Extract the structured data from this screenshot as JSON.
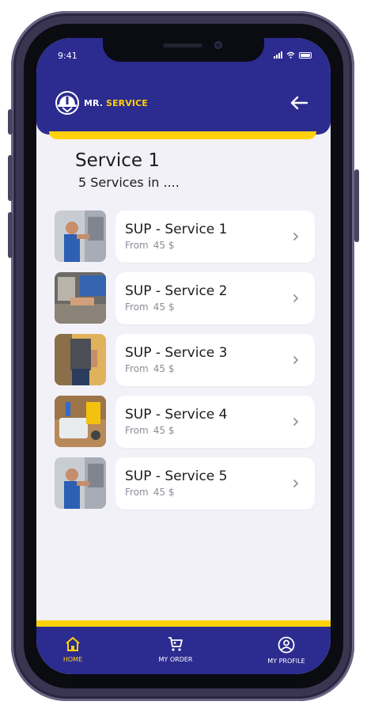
{
  "status": {
    "time": "9:41"
  },
  "header": {
    "brand_first": "MR.",
    "brand_second": "SERVICE"
  },
  "page": {
    "title": "Service 1",
    "subtitle": "5 Services in ...."
  },
  "services": [
    {
      "name": "SUP - Service 1",
      "price_prefix": "From",
      "price": "45 $"
    },
    {
      "name": "SUP - Service 2",
      "price_prefix": "From",
      "price": "45 $"
    },
    {
      "name": "SUP - Service 3",
      "price_prefix": "From",
      "price": "45 $"
    },
    {
      "name": "SUP - Service 4",
      "price_prefix": "From",
      "price": "45 $"
    },
    {
      "name": "SUP - Service 5",
      "price_prefix": "From",
      "price": "45 $"
    }
  ],
  "nav": [
    {
      "label": "HOME",
      "icon": "home-icon",
      "active": true
    },
    {
      "label": "MY ORDER",
      "icon": "cart-icon",
      "active": false
    },
    {
      "label": "MY PROFILE",
      "icon": "profile-icon",
      "active": false
    }
  ],
  "colors": {
    "primary": "#2c2b8f",
    "accent": "#ffd10b",
    "background": "#f2f1f8",
    "card": "#ffffff"
  }
}
